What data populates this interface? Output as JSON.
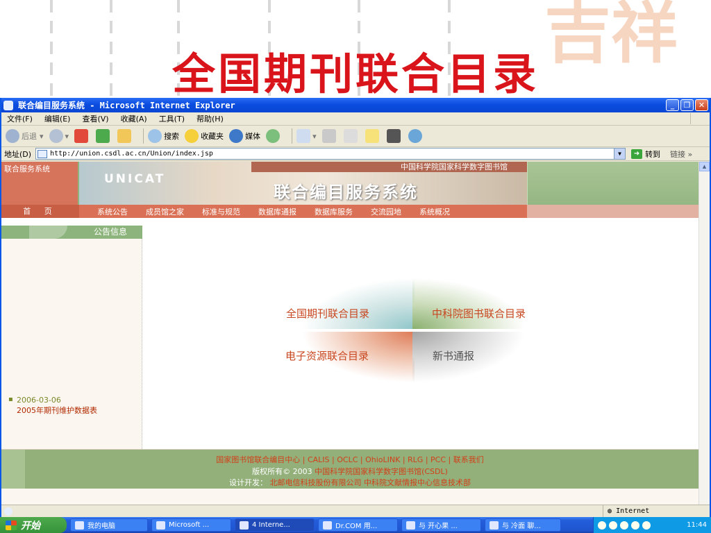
{
  "slide": {
    "title": "全国期刊联合目录"
  },
  "window": {
    "title": "联合编目服务系统 - Microsoft Internet Explorer",
    "controls": [
      "_",
      "❐",
      "✕"
    ]
  },
  "menu": [
    "文件(F)",
    "编辑(E)",
    "查看(V)",
    "收藏(A)",
    "工具(T)",
    "帮助(H)"
  ],
  "toolbar": {
    "back": "后退",
    "search": "搜索",
    "favorites": "收藏夹",
    "media": "媒体"
  },
  "address": {
    "label": "地址(D)",
    "url": "http://union.csdl.ac.cn/Union/index.jsp",
    "go": "转到",
    "links": "链接 »"
  },
  "site": {
    "banner_left": "联合服务系统",
    "banner_top": "中国科学院国家科学数字图书馆",
    "logo": "UNICAT",
    "system_title": "联合编目服务系统",
    "nav": [
      "首 页",
      "系统公告",
      "成员馆之家",
      "标准与规范",
      "数据库通报",
      "数据库服务",
      "交流园地",
      "系统概况"
    ],
    "notice_header": "公告信息",
    "news": {
      "date": "2006-03-06",
      "title": "2005年期刊维护数据表"
    },
    "quadrants": [
      "全国期刊联合目录",
      "中科院图书联合目录",
      "电子资源联合目录",
      "新书通报"
    ],
    "footer": {
      "links": [
        "国家图书馆联合编目中心",
        "CALIS",
        "OCLC",
        "OhioLINK",
        "RLG",
        "PCC",
        "联系我们"
      ],
      "copyright_prefix": "版权所有© 2003",
      "copyright_org": "中国科学院国家科学数字图书馆(CSDL)",
      "dev_label": "设计开发：",
      "dev_org": "北邮电信科技股份有限公司 中科院文献情报中心信息技术部"
    }
  },
  "status": {
    "zone": "Internet"
  },
  "taskbar": {
    "start": "开始",
    "tasks": [
      "我的电脑",
      "Microsoft ...",
      "4 Interne...",
      "Dr.COM 用...",
      "与 开心果 ...",
      "与 冷面 聊..."
    ],
    "clock": "11:44"
  },
  "colors": {
    "accent_red": "#d9141b",
    "nav_orange": "#da7156",
    "footer_green": "#93b07b",
    "xp_blue": "#0a56e6"
  }
}
